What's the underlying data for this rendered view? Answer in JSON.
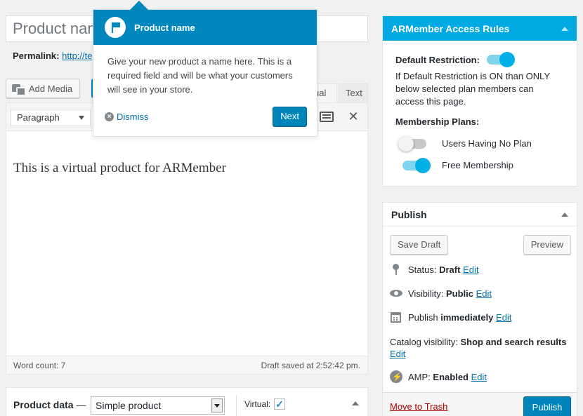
{
  "title_input": {
    "value": "Product name"
  },
  "permalink": {
    "label": "Permalink:",
    "url": "http://te"
  },
  "media": {
    "add_label": "Add Media"
  },
  "editor_tabs": {
    "visual": "ual",
    "text": "Text"
  },
  "editor": {
    "format": "Paragraph",
    "content": "This is a virtual product for ARMember",
    "word_count": "Word count: 7",
    "draft_saved": "Draft saved at 2:52:42 pm."
  },
  "pointer": {
    "title": "Product name",
    "body": "Give your new product a name here. This is a required field and will be what your customers will see in your store.",
    "dismiss": "Dismiss",
    "next": "Next"
  },
  "product_data": {
    "label": "Product data",
    "dash": "—",
    "type": "Simple product",
    "virtual_label": "Virtual:",
    "virtual_checked": "✓"
  },
  "armember": {
    "title": "ARMember Access Rules",
    "default_restriction_label": "Default Restriction:",
    "default_restriction_on": true,
    "description": "If Default Restriction is ON than ONLY below selected plan members can access this page.",
    "plans_label": "Membership Plans:",
    "plans": [
      {
        "name": "Users Having No Plan",
        "enabled": false
      },
      {
        "name": "Free Membership",
        "enabled": true
      }
    ]
  },
  "publish": {
    "title": "Publish",
    "save_draft": "Save Draft",
    "preview": "Preview",
    "status_label": "Status:",
    "status_value": "Draft",
    "visibility_label": "Visibility:",
    "visibility_value": "Public",
    "publish_label": "Publish",
    "publish_value": "immediately",
    "catalog_label": "Catalog visibility:",
    "catalog_value": "Shop and search results",
    "amp_label": "AMP:",
    "amp_value": "Enabled",
    "edit": "Edit",
    "trash": "Move to Trash",
    "publish_button": "Publish"
  },
  "colors": {
    "accent": "#0085ba",
    "armember_header": "#00a9e2",
    "toggle_on": "#00b0e6",
    "trash": "#aa0000"
  }
}
